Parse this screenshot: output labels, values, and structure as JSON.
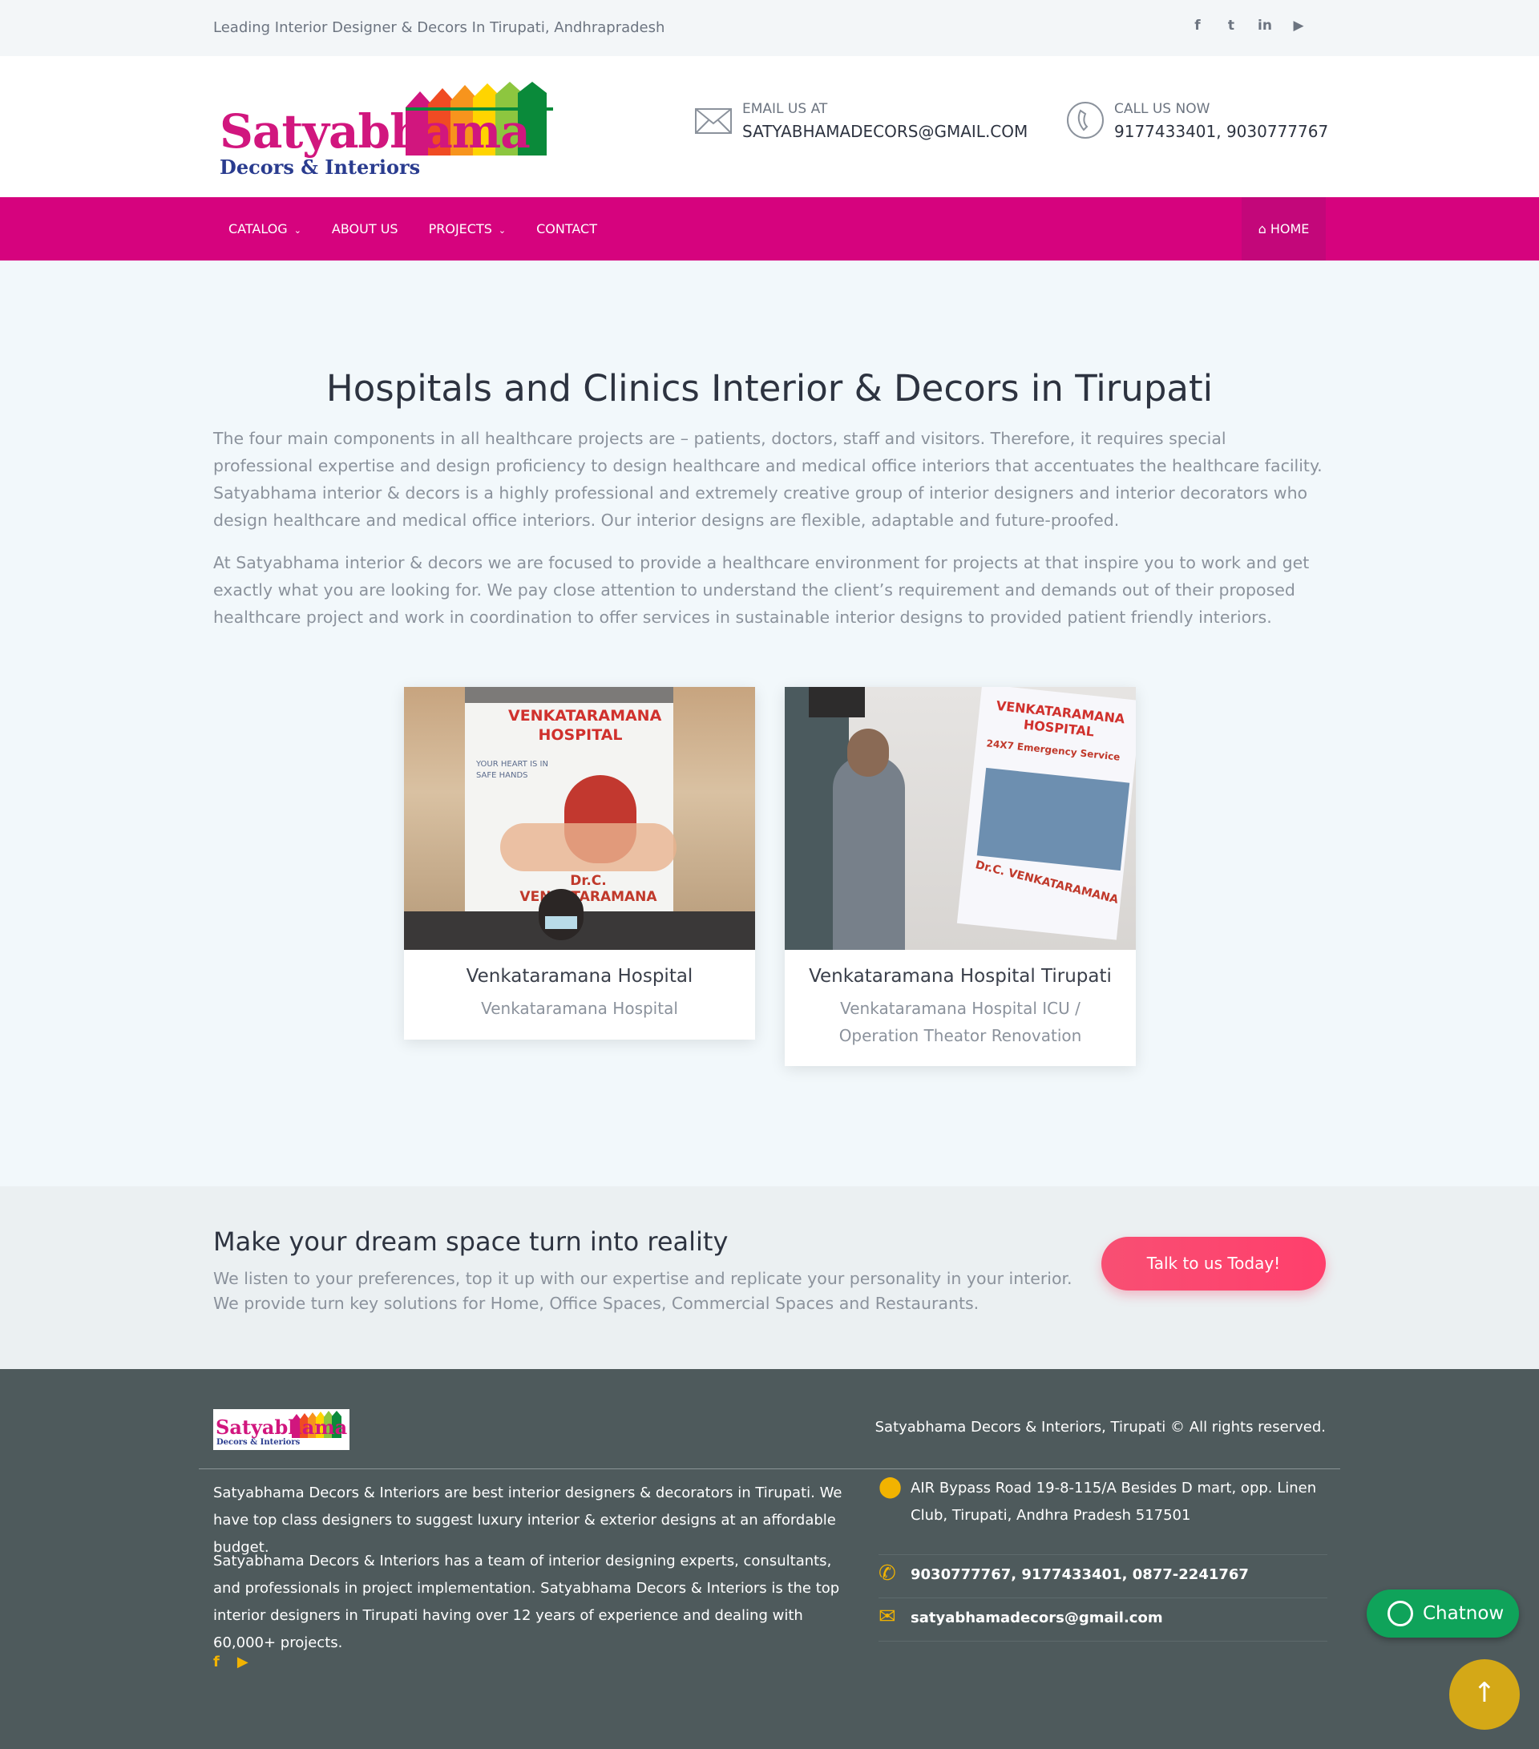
{
  "topbar": {
    "tagline": "Leading Interior Designer & Decors In Tirupati, Andhrapradesh",
    "social": [
      "facebook-icon",
      "twitter-icon",
      "linkedin-icon",
      "youtube-icon"
    ]
  },
  "header": {
    "logo_name": "Satyabhama",
    "logo_sub": "Decors & Interiors",
    "email_label": "EMAIL US AT",
    "email_value": "SATYABHAMADECORS@GMAIL.COM",
    "call_label": "CALL US NOW",
    "call_value": "9177433401, 9030777767"
  },
  "nav": {
    "items": [
      {
        "label": "CATALOG",
        "has_dropdown": true
      },
      {
        "label": "ABOUT US",
        "has_dropdown": false
      },
      {
        "label": "PROJECTS",
        "has_dropdown": true
      },
      {
        "label": "CONTACT",
        "has_dropdown": false
      }
    ],
    "home_label": "HOME"
  },
  "main": {
    "title": "Hospitals and Clinics Interior & Decors in Tirupati",
    "paragraphs": [
      "The four main components in all healthcare projects are – patients, doctors, staff and visitors. Therefore, it requires special professional expertise and design proficiency to design healthcare and medical office interiors that accentuates the healthcare facility. Satyabhama interior & decors is a highly professional and extremely creative group of interior designers and interior decorators who design healthcare and medical office interiors. Our interior designs are flexible, adaptable and future-proofed.",
      "At Satyabhama interior & decors we are focused to provide a healthcare environment for projects at that inspire you to work and get exactly what you are looking for. We pay close attention to understand the client’s requirement and demands out of their proposed healthcare project and work in coordination to offer services in sustainable interior designs to provided patient friendly interiors."
    ],
    "cards": [
      {
        "title": "Venkataramana Hospital",
        "subtitle": "Venkataramana Hospital",
        "poster_title": "VENKATARAMANA HOSPITAL",
        "poster_tag": "YOUR HEART IS IN SAFE HANDS",
        "poster_doctor": "Dr.C. VENKATARAMANA"
      },
      {
        "title": "Venkataramana Hospital Tirupati",
        "subtitle": "Venkataramana Hospital ICU / Operation Theator Renovation",
        "poster_title": "VENKATARAMANA HOSPITAL",
        "poster_tag": "24X7 Emergency Service",
        "poster_doctor": "Dr.C. VENKATARAMANA"
      }
    ]
  },
  "cta": {
    "heading": "Make your dream space turn into reality",
    "line1": "We listen to your preferences, top it up with our expertise and replicate your personality in your interior.",
    "line2": "We provide turn key solutions for Home, Office Spaces, Commercial Spaces and Restaurants.",
    "button": "Talk to us Today!"
  },
  "footer": {
    "logo_name": "Satyabhama",
    "logo_sub": "Decors & Interiors",
    "copyright": "Satyabhama Decors & Interiors, Tirupati © All rights reserved.",
    "about1": "Satyabhama Decors & Interiors are best interior designers & decorators in Tirupati. We have top class designers to suggest luxury interior & exterior designs at an affordable budget.",
    "about2": "Satyabhama Decors & Interiors has a team of interior designing experts, consultants, and professionals in project implementation. Satyabhama Decors & Interiors is the top interior designers in Tirupati having over 12 years of experience and dealing with 60,000+ projects.",
    "address": "AIR Bypass Road 19-8-115/A Besides D mart, opp. Linen Club, Tirupati, Andhra Pradesh 517501",
    "phones": "9030777767, 9177433401, 0877-2241767",
    "email": "satyabhamadecors@gmail.com",
    "social": [
      "facebook-icon",
      "youtube-icon"
    ]
  },
  "widgets": {
    "chat_label": "Chatnow"
  },
  "colors": {
    "brand_magenta": "#d6037e",
    "cta_pink": "#f84f73",
    "footer_bg": "#4e5a5c",
    "accent_yellow": "#f2b300",
    "whatsapp_green": "#0fa35a"
  }
}
